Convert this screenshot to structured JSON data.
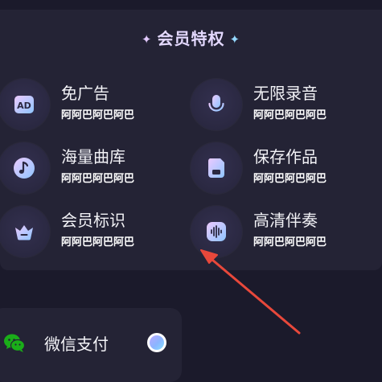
{
  "privileges": {
    "title": "会员特权",
    "star_left": "✦",
    "star_right": "✦",
    "items": [
      {
        "title": "免广告",
        "desc": "阿阿巴阿巴阿巴",
        "icon": "ad-icon"
      },
      {
        "title": "无限录音",
        "desc": "阿阿巴阿巴阿巴",
        "icon": "microphone-icon"
      },
      {
        "title": "海量曲库",
        "desc": "阿阿巴阿巴阿巴",
        "icon": "music-note-icon"
      },
      {
        "title": "保存作品",
        "desc": "阿阿巴阿巴阿巴",
        "icon": "save-icon"
      },
      {
        "title": "会员标识",
        "desc": "阿阿巴阿巴阿巴",
        "icon": "crown-icon"
      },
      {
        "title": "高清伴奏",
        "desc": "阿阿巴阿巴阿巴",
        "icon": "soundwave-icon"
      }
    ],
    "ad_icon_text": "AD"
  },
  "payment": {
    "method_label": "微信支付",
    "icon": "wechat-icon",
    "selected": true
  },
  "colors": {
    "background": "#1b1a2b",
    "card": "#242335",
    "icon_gradient_start": "#e6c8ff",
    "icon_gradient_end": "#8fc3ff",
    "wechat_green": "#1aad19",
    "annotation_arrow": "#e8483b"
  }
}
